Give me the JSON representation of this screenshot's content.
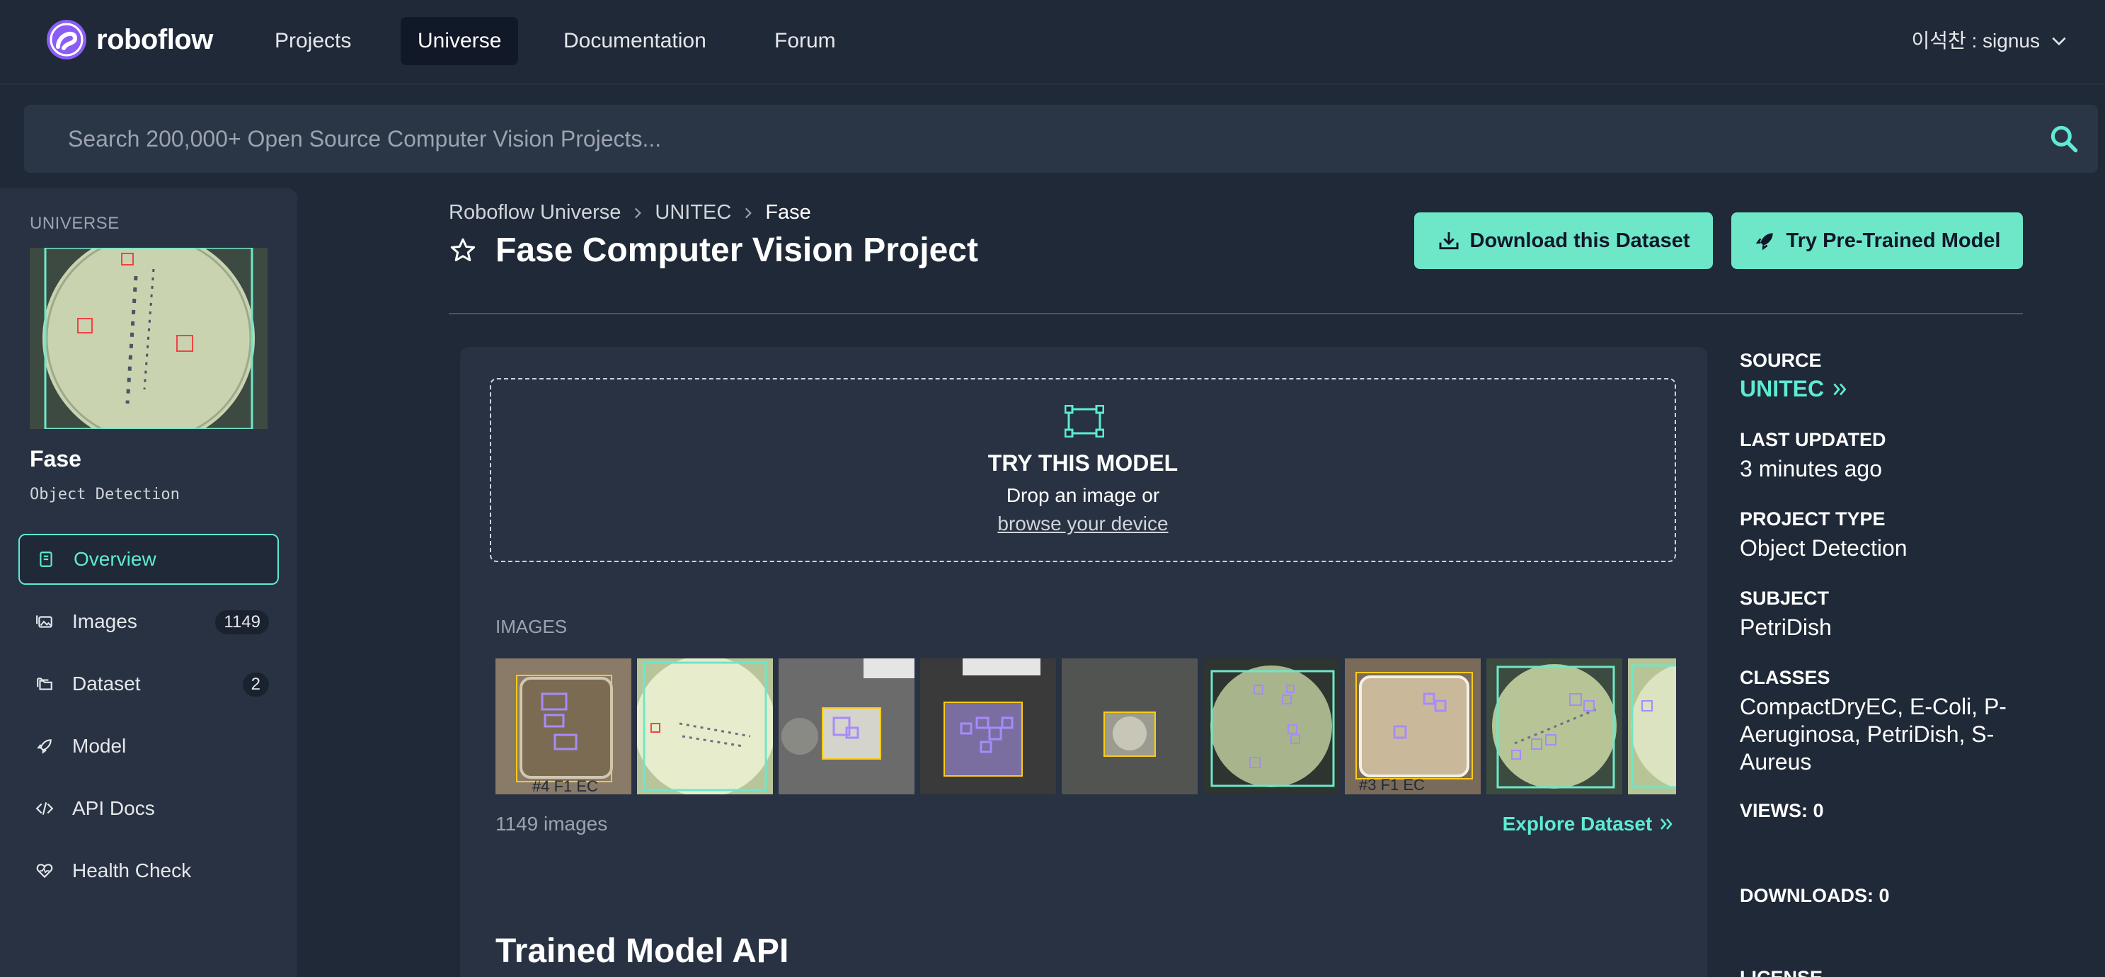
{
  "nav": {
    "brand": "roboflow",
    "links": [
      "Projects",
      "Universe",
      "Documentation",
      "Forum"
    ],
    "active": "Universe",
    "user": "이석찬 : signus"
  },
  "search": {
    "placeholder": "Search 200,000+ Open Source Computer Vision Projects..."
  },
  "sidebar": {
    "kicker": "UNIVERSE",
    "project_name": "Fase",
    "project_type": "Object Detection",
    "items": [
      {
        "label": "Overview",
        "icon": "book-icon",
        "active": true
      },
      {
        "label": "Images",
        "icon": "images-icon",
        "count": "1149"
      },
      {
        "label": "Dataset",
        "icon": "folders-icon",
        "count": "2"
      },
      {
        "label": "Model",
        "icon": "rocket-icon"
      },
      {
        "label": "API Docs",
        "icon": "code-icon"
      },
      {
        "label": "Health Check",
        "icon": "heart-pulse-icon"
      }
    ]
  },
  "header": {
    "breadcrumb": [
      "Roboflow Universe",
      "UNITEC",
      "Fase"
    ],
    "title": "Fase Computer Vision Project",
    "download_btn": "Download this Dataset",
    "pretrained_btn": "Try Pre-Trained Model"
  },
  "try_model": {
    "title": "TRY THIS MODEL",
    "text": "Drop an image or",
    "link": "browse your device"
  },
  "images": {
    "kicker": "IMAGES",
    "count_label": "1149 images",
    "explore_label": "Explore Dataset"
  },
  "api_title": "Trained Model API",
  "meta": {
    "source_label": "SOURCE",
    "source_value": "UNITEC",
    "updated_label": "LAST UPDATED",
    "updated_value": "3 minutes ago",
    "type_label": "PROJECT TYPE",
    "type_value": "Object Detection",
    "subject_label": "SUBJECT",
    "subject_value": "PetriDish",
    "classes_label": "CLASSES",
    "classes_value": "CompactDryEC, E-Coli, P-Aeruginosa, PetriDish, S-Aureus",
    "views_label": "VIEWS: 0",
    "downloads_label": "DOWNLOADS: 0",
    "license_label": "LICENSE"
  },
  "colors": {
    "accent": "#5eead4",
    "button": "#6ee7c8",
    "background": "#1f2937",
    "panel": "#283242",
    "brand": "#8b5cf6"
  }
}
